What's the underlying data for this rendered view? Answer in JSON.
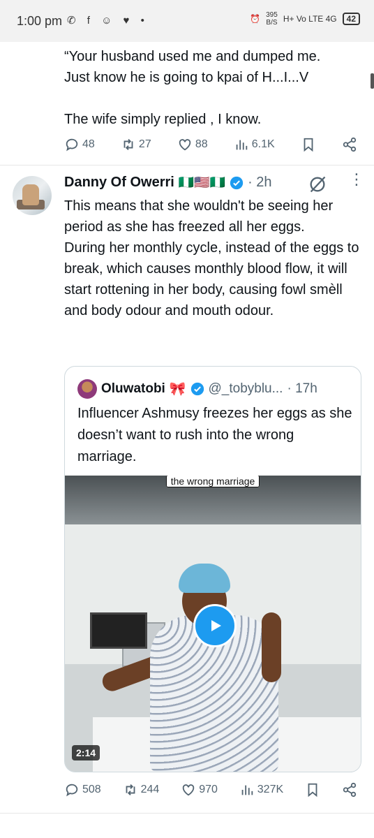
{
  "status_bar": {
    "time": "1:00 pm",
    "notif_icons": "✆ f ☺ ♥ •",
    "net_speed_top": "395",
    "net_speed_unit": "B/S",
    "network": "H+ Vo LTE 4G",
    "battery": "42"
  },
  "previous_tweet": {
    "text": "“Your husband used me and dumped me.\nJust know he is going to kpai  of H...I...V\n\nThe wife simply replied ,  I know.",
    "replies": "48",
    "retweets": "27",
    "likes": "88",
    "views": "6.1K"
  },
  "tweet": {
    "author_name": "Danny Of Owerri",
    "author_flags": "🇳🇬🇺🇸🇳🇬",
    "time": "· 2h",
    "text": "This means that she wouldn't be seeing her period as she has freezed all her eggs.\nDuring her monthly cycle, instead of the eggs to break, which causes monthly blood flow, it will start rottening in her body, causing fowl smèll and body odour and mouth odour.",
    "replies": "508",
    "retweets": "244",
    "likes": "970",
    "views": "327K"
  },
  "quoted": {
    "author_name": "Oluwatobi",
    "emoji": "🎀",
    "handle": "@_tobyblu...",
    "time": "· 17h",
    "text": "Influencer Ashmusy freezes her eggs as she doesn’t want to rush into the wrong marriage.",
    "video_caption": "the wrong marriage",
    "duration": "2:14"
  },
  "colors": {
    "accent": "#1d9bf0",
    "secondary_text": "#536471",
    "border": "#cfd9de"
  },
  "icons": [
    "reply-icon",
    "retweet-icon",
    "like-icon",
    "views-icon",
    "bookmark-icon",
    "share-icon",
    "verified-icon",
    "grok-icon",
    "more-icon",
    "play-icon"
  ]
}
